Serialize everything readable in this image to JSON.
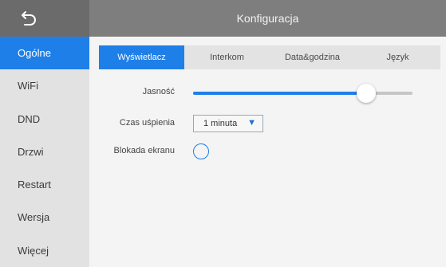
{
  "header": {
    "title": "Konfiguracja",
    "back_icon": "back-arrow-icon"
  },
  "sidebar": {
    "items": [
      {
        "label": "Ogólne",
        "active": true
      },
      {
        "label": "WiFi"
      },
      {
        "label": "DND"
      },
      {
        "label": "Drzwi"
      },
      {
        "label": "Restart"
      },
      {
        "label": "Wersja"
      },
      {
        "label": "Więcej"
      }
    ]
  },
  "tabs": [
    {
      "label": "Wyświetlacz",
      "active": true
    },
    {
      "label": "Interkom"
    },
    {
      "label": "Data&godzina"
    },
    {
      "label": "Język"
    }
  ],
  "display": {
    "brightness_label": "Jasność",
    "brightness_fraction": 0.79,
    "sleep_label": "Czas uśpienia",
    "sleep_value": "1 minuta",
    "lock_label": "Blokada ekranu",
    "lock_enabled": false
  },
  "colors": {
    "accent": "#1f7fe9",
    "topbar": "#7e7e7e"
  }
}
